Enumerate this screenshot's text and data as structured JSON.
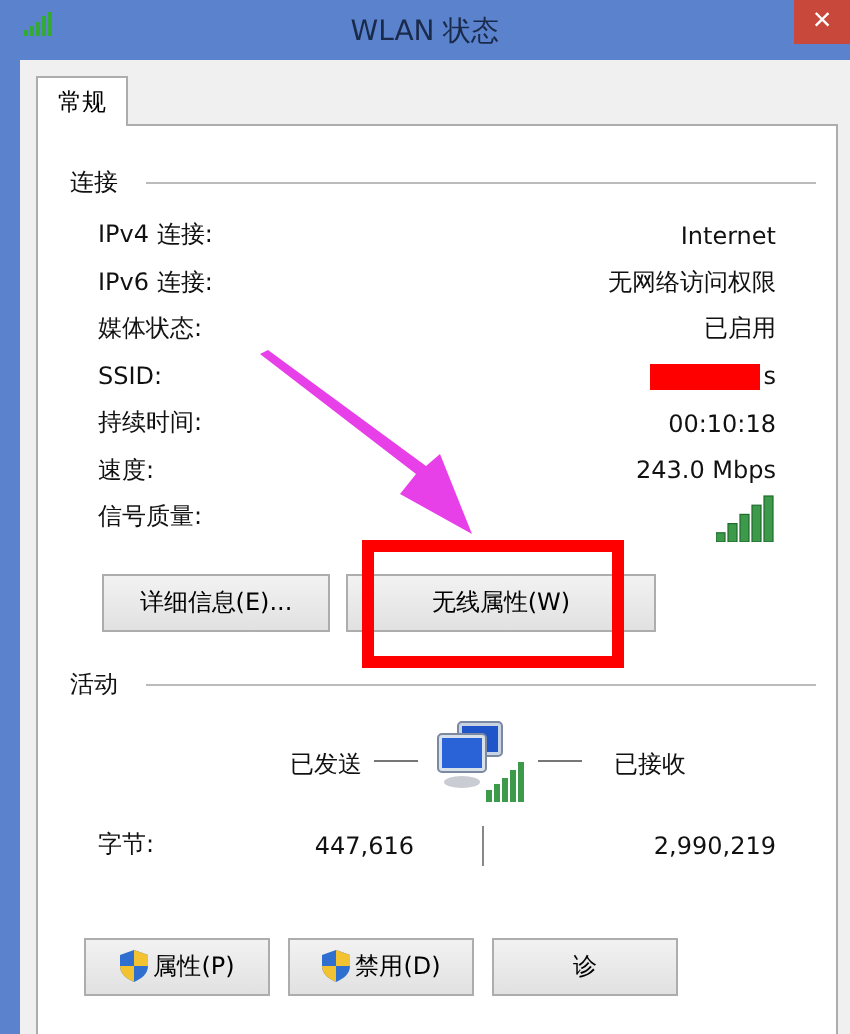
{
  "window": {
    "title": "WLAN 状态",
    "close": "×"
  },
  "tabs": [
    {
      "label": "常规",
      "selected": true
    }
  ],
  "connection": {
    "heading": "连接",
    "rows": [
      {
        "kind": "text",
        "label": "IPv4 连接:",
        "value": "Internet"
      },
      {
        "kind": "text",
        "label": "IPv6 连接:",
        "value": "无网络访问权限"
      },
      {
        "kind": "text",
        "label": "媒体状态:",
        "value": "已启用"
      },
      {
        "kind": "redacted",
        "label": "SSID:",
        "value": "s"
      },
      {
        "kind": "text",
        "label": "持续时间:",
        "value": "00:10:18"
      },
      {
        "kind": "text",
        "label": "速度:",
        "value": "243.0 Mbps"
      },
      {
        "kind": "signal",
        "label": "信号质量:"
      }
    ],
    "buttons": [
      "详细信息(E)...",
      "无线属性(W)"
    ]
  },
  "activity": {
    "heading": "活动",
    "sent": "已发送",
    "received": "已接收",
    "bytes_label": "字节:",
    "bytes_sent": "447,616",
    "bytes_received": "2,990,219"
  },
  "buttons": [
    {
      "label": "属性(P)",
      "shield": true
    },
    {
      "label": "禁用(D)",
      "shield": true
    },
    {
      "label": "诊",
      "shield": false
    }
  ]
}
